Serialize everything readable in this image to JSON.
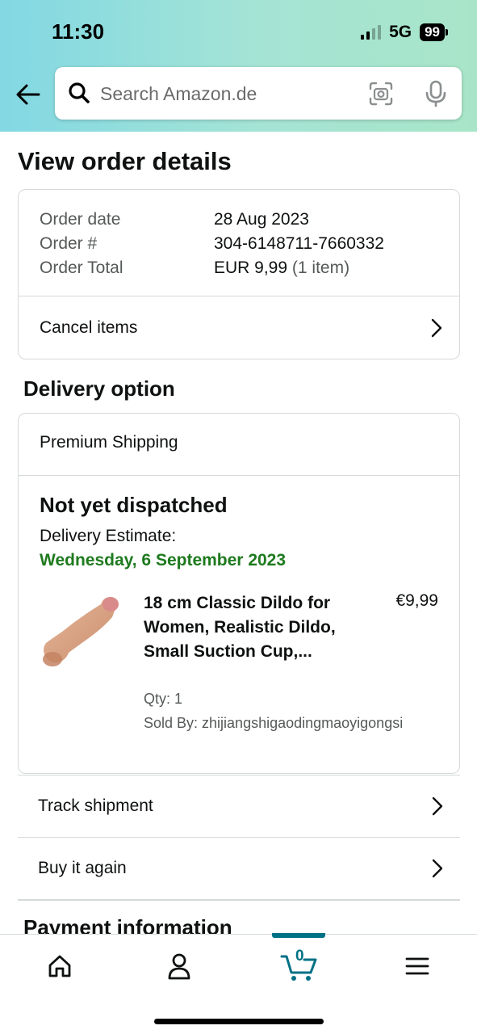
{
  "status_bar": {
    "time": "11:30",
    "network": "5G",
    "battery": "99"
  },
  "search": {
    "placeholder": "Search Amazon.de"
  },
  "page": {
    "title": "View order details"
  },
  "order_summary": {
    "rows": [
      {
        "label": "Order date",
        "value": "28 Aug 2023",
        "extra": ""
      },
      {
        "label": "Order #",
        "value": "304-6148711-7660332",
        "extra": ""
      },
      {
        "label": "Order Total",
        "value": "EUR 9,99",
        "extra": "(1 item)"
      }
    ],
    "cancel_label": "Cancel items"
  },
  "delivery": {
    "section_title": "Delivery option",
    "shipping_method": "Premium Shipping",
    "status": "Not yet dispatched",
    "estimate_label": "Delivery Estimate:",
    "estimate_date": "Wednesday, 6 September 2023",
    "estimate_color": "#1e7a1e",
    "product": {
      "title": "18 cm Classic Dildo for Women, Realistic Dildo, Small Suction Cup,...",
      "price": "€9,99",
      "qty": "Qty: 1",
      "seller": "Sold By: zhijiangshigaodingmaoyigongsi"
    }
  },
  "actions": {
    "track": "Track shipment",
    "buy_again": "Buy it again"
  },
  "payment": {
    "section_title": "Payment information"
  },
  "bottom_nav": {
    "items": [
      "home-icon",
      "account-icon",
      "cart-icon",
      "menu-icon"
    ],
    "cart_count": "0",
    "active_color": "#007185"
  }
}
